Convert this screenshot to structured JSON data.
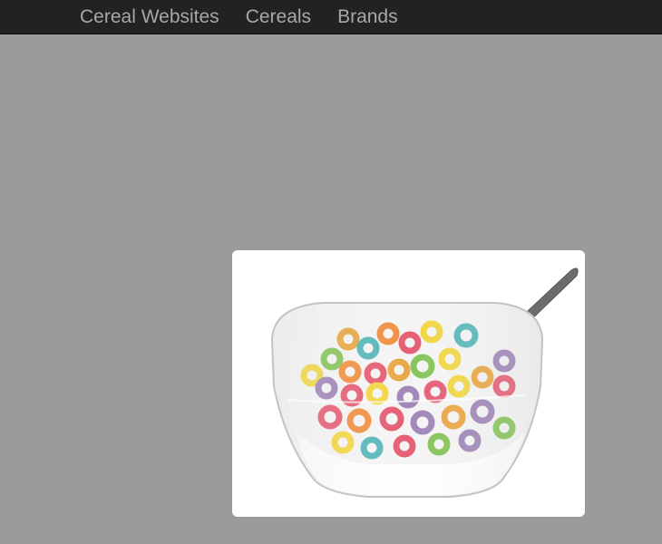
{
  "navbar": {
    "items": [
      {
        "label": "Cereal Websites"
      },
      {
        "label": "Cereals"
      },
      {
        "label": "Brands"
      }
    ]
  },
  "colors": {
    "navbar_bg": "#222222",
    "nav_text": "#a8a8a8",
    "page_bg": "#9b9b9b",
    "card_bg": "#ffffff"
  },
  "image": {
    "subject": "cereal-bowl-image"
  }
}
